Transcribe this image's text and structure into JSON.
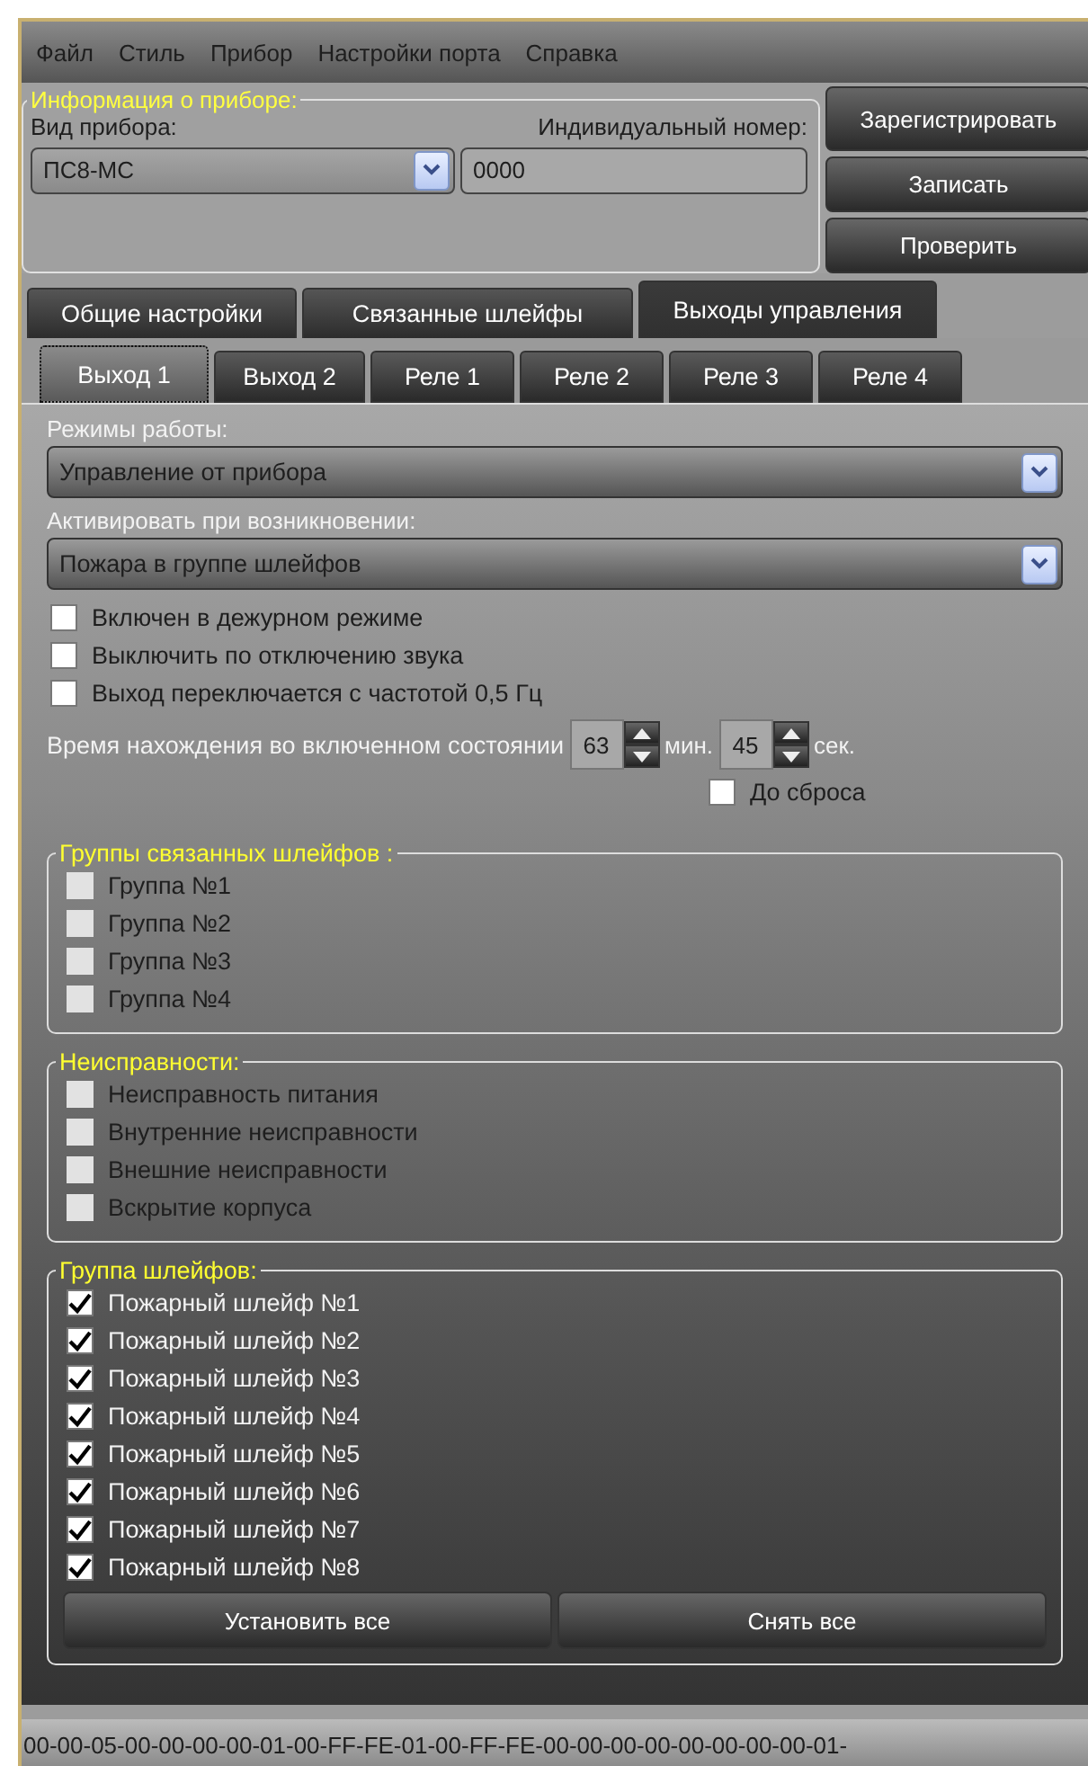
{
  "menu": [
    "Файл",
    "Стиль",
    "Прибор",
    "Настройки порта",
    "Справка"
  ],
  "device_info": {
    "title": "Информация о приборе:",
    "type_label": "Вид прибора:",
    "type_value": "ПС8-МС",
    "serial_label": "Индивидуальный номер:",
    "serial_value": "0000"
  },
  "action_buttons": [
    "Зарегистрировать",
    "Записать",
    "Проверить"
  ],
  "tabs": [
    {
      "label": "Общие настройки",
      "selected": false
    },
    {
      "label": "Связанные шлейфы",
      "selected": false
    },
    {
      "label": "Выходы управления",
      "selected": true
    }
  ],
  "sub_tabs": [
    {
      "label": "Выход 1",
      "selected": true
    },
    {
      "label": "Выход 2",
      "selected": false
    },
    {
      "label": "Реле 1",
      "selected": false
    },
    {
      "label": "Реле 2",
      "selected": false
    },
    {
      "label": "Реле 3",
      "selected": false
    },
    {
      "label": "Реле 4",
      "selected": false
    }
  ],
  "mode": {
    "label": "Режимы работы:",
    "value": "Управление от прибора"
  },
  "activation": {
    "label": "Активировать при возникновении:",
    "value": "Пожара в группе шлейфов"
  },
  "options": [
    {
      "label": "Включен в дежурном режиме",
      "checked": false
    },
    {
      "label": "Выключить по отключению звука",
      "checked": false
    },
    {
      "label": "Выход переключается с частотой 0,5 Гц",
      "checked": false
    }
  ],
  "duration": {
    "label": "Время нахождения во включенном состоянии",
    "minutes": "63",
    "minutes_unit": "мин.",
    "seconds": "45",
    "seconds_unit": "сек.",
    "until_reset": {
      "label": "До сброса",
      "checked": false
    }
  },
  "groups": [
    {
      "title": "Группы связанных шлейфов :",
      "items": [
        {
          "label": "Группа №1",
          "checked": false,
          "disabled": true
        },
        {
          "label": "Группа №2",
          "checked": false,
          "disabled": true
        },
        {
          "label": "Группа №3",
          "checked": false,
          "disabled": true
        },
        {
          "label": "Группа №4",
          "checked": false,
          "disabled": true
        }
      ]
    },
    {
      "title": "Неисправности:",
      "items": [
        {
          "label": "Неисправность питания",
          "checked": false,
          "disabled": true
        },
        {
          "label": "Внутренние неисправности",
          "checked": false,
          "disabled": true
        },
        {
          "label": "Внешние неисправности",
          "checked": false,
          "disabled": true
        },
        {
          "label": "Вскрытие корпуса",
          "checked": false,
          "disabled": true
        }
      ]
    },
    {
      "title": "Группа шлейфов:",
      "items": [
        {
          "label": "Пожарный шлейф №1",
          "checked": true,
          "disabled": false
        },
        {
          "label": "Пожарный шлейф №2",
          "checked": true,
          "disabled": false
        },
        {
          "label": "Пожарный шлейф №3",
          "checked": true,
          "disabled": false
        },
        {
          "label": "Пожарный шлейф №4",
          "checked": true,
          "disabled": false
        },
        {
          "label": "Пожарный шлейф №5",
          "checked": true,
          "disabled": false
        },
        {
          "label": "Пожарный шлейф №6",
          "checked": true,
          "disabled": false
        },
        {
          "label": "Пожарный шлейф №7",
          "checked": true,
          "disabled": false
        },
        {
          "label": "Пожарный шлейф №8",
          "checked": true,
          "disabled": false
        }
      ],
      "buttons": [
        "Установить все",
        "Снять все"
      ]
    }
  ],
  "status_bar": "00-00-05-00-00-00-00-01-00-FF-FE-01-00-FF-FE-00-00-00-00-00-00-00-00-01-"
}
